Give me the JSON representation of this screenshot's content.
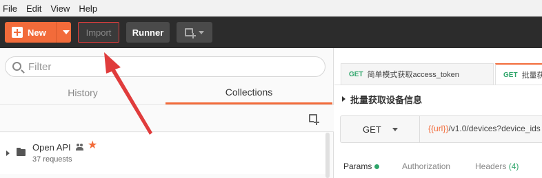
{
  "menubar": {
    "items": [
      "File",
      "Edit",
      "View",
      "Help"
    ]
  },
  "toolbar": {
    "new_label": "New",
    "import_label": "Import",
    "runner_label": "Runner"
  },
  "sidebar": {
    "filter_placeholder": "Filter",
    "tabs": {
      "history": "History",
      "collections": "Collections"
    },
    "collection": {
      "name": "Open API",
      "count": "37 requests"
    }
  },
  "main": {
    "tabs": [
      {
        "method": "GET",
        "title": "简单模式获取access_token"
      },
      {
        "method": "GET",
        "title": "批量获"
      }
    ],
    "request_title": "批量获取设备信息",
    "method": "GET",
    "url_var": "{{url}}",
    "url_rest": "/v1.0/devices?device_ids",
    "sub_tabs": {
      "params": "Params",
      "authorization": "Authorization",
      "headers": "Headers",
      "headers_count": "(4)"
    }
  },
  "colors": {
    "accent": "#f26b3a",
    "get_green": "#2ea56a",
    "toolbar_bg": "#2c2c2c",
    "annotation_red": "#e03c3c"
  }
}
